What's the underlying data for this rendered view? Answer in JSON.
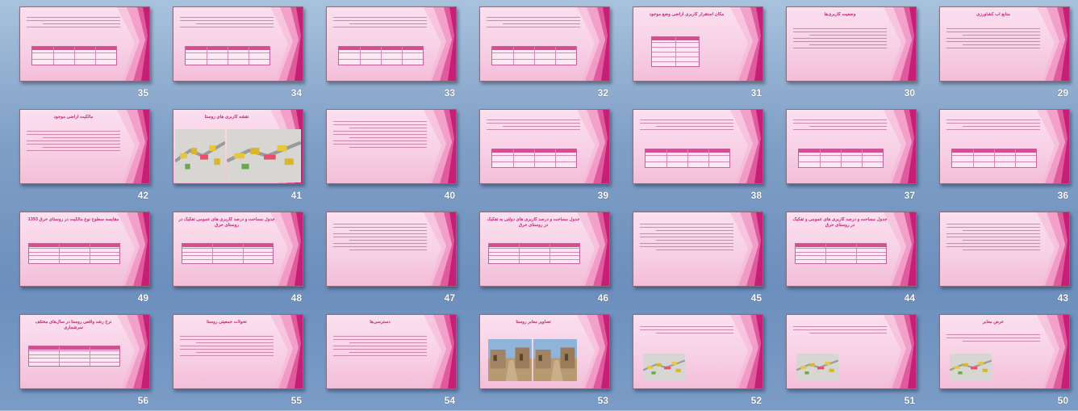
{
  "view": "Slide Sorter",
  "slides": [
    {
      "number": "29",
      "title": "منابع آب کشاورزی",
      "layout": "text"
    },
    {
      "number": "30",
      "title": "وضعیت کاربری‌ها",
      "layout": "text"
    },
    {
      "number": "31",
      "title": "مکان استقرار کاربری اراضی وضع موجود",
      "layout": "table-left"
    },
    {
      "number": "32",
      "title": "",
      "layout": "text-table"
    },
    {
      "number": "33",
      "title": "",
      "layout": "text-table"
    },
    {
      "number": "34",
      "title": "",
      "layout": "text-table"
    },
    {
      "number": "35",
      "title": "",
      "layout": "text-table"
    },
    {
      "number": "36",
      "title": "",
      "layout": "text-table"
    },
    {
      "number": "37",
      "title": "",
      "layout": "text-table"
    },
    {
      "number": "38",
      "title": "",
      "layout": "text-table"
    },
    {
      "number": "39",
      "title": "",
      "layout": "text-table"
    },
    {
      "number": "40",
      "title": "",
      "layout": "text"
    },
    {
      "number": "41",
      "title": "نقشه کاربری های روستا",
      "layout": "map"
    },
    {
      "number": "42",
      "title": "مالکیت اراضی موجود",
      "layout": "text"
    },
    {
      "number": "43",
      "title": "",
      "layout": "text"
    },
    {
      "number": "44",
      "title": "جدول مساحت و درصد کاربری های عمومی و تفکیک در روستای حرق",
      "layout": "table"
    },
    {
      "number": "45",
      "title": "",
      "layout": "text"
    },
    {
      "number": "46",
      "title": "جدول مساحت و درصد کاربری های دولتی به تفکیک در روستای حرق",
      "layout": "table"
    },
    {
      "number": "47",
      "title": "",
      "layout": "text"
    },
    {
      "number": "48",
      "title": "جدول مساحت و درصد کاربری های عمومی تفکیک در روستای حرق",
      "layout": "table"
    },
    {
      "number": "49",
      "title": "مقایسه سطوح نوع مالکیت در روستای حرق 1393",
      "layout": "table"
    },
    {
      "number": "50",
      "title": "عرض معابر",
      "layout": "text-image"
    },
    {
      "number": "51",
      "title": "",
      "layout": "text-image"
    },
    {
      "number": "52",
      "title": "",
      "layout": "text-image"
    },
    {
      "number": "53",
      "title": "تصاویر معابر روستا",
      "layout": "photos"
    },
    {
      "number": "54",
      "title": "دسترسی‌ها",
      "layout": "text"
    },
    {
      "number": "55",
      "title": "تحولات جمعیتی روستا",
      "layout": "text"
    },
    {
      "number": "56",
      "title": "نرخ رشد واقعی روستا در سال‌های مختلف سرشماری",
      "layout": "table"
    }
  ],
  "theme": {
    "accent": "#c8287a",
    "slide_bg": "#f7cfe4",
    "desktop_bg": "#7f9fc6"
  }
}
